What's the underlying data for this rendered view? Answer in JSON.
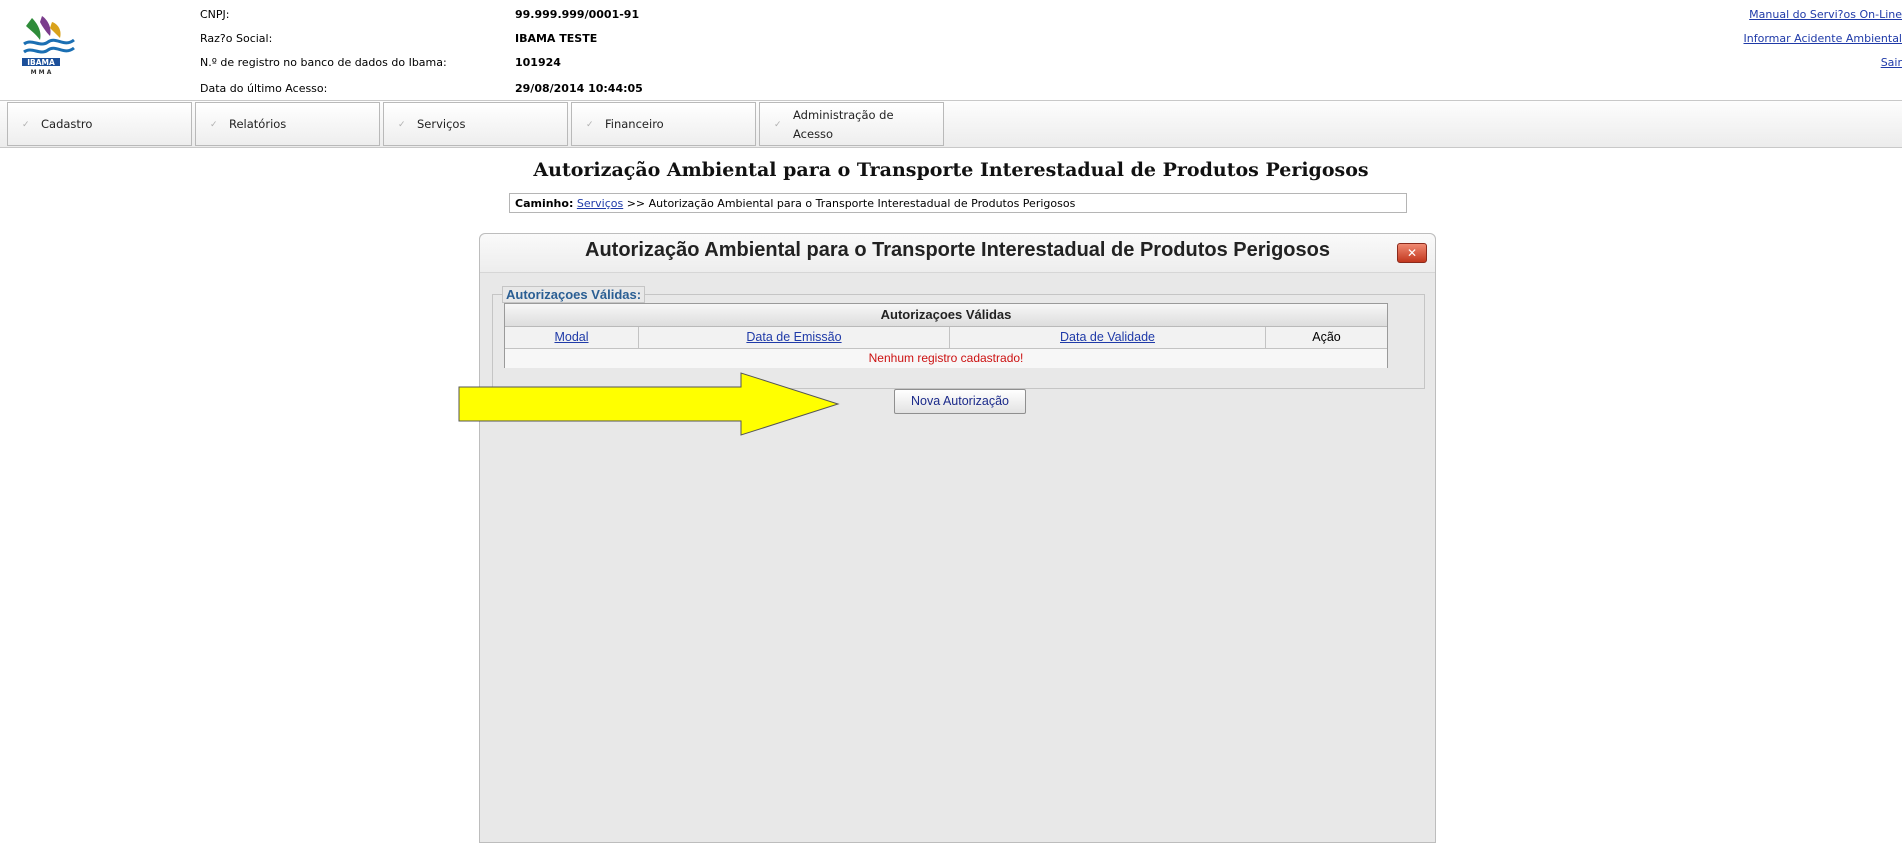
{
  "header": {
    "logo_text": "IBAMA",
    "logo_subtext": "M M A",
    "info": [
      {
        "label": "CNPJ:",
        "value": "99.999.999/0001-91"
      },
      {
        "label": "Raz?o Social:",
        "value": "IBAMA TESTE"
      },
      {
        "label": "N.º de registro no banco de dados do Ibama:",
        "value": "101924"
      },
      {
        "label": "Data do último Acesso:",
        "value": "29/08/2014 10:44:05"
      }
    ],
    "links": [
      "Manual do Servi?os On-Line",
      "Informar Acidente Ambiental",
      "Sair"
    ]
  },
  "menu": [
    {
      "label": "Cadastro"
    },
    {
      "label": "Relatórios"
    },
    {
      "label": "Serviços"
    },
    {
      "label": "Financeiro"
    },
    {
      "label_line1": "Administração de",
      "label_line2": "Acesso"
    }
  ],
  "page": {
    "title": "Autorização Ambiental para o Transporte Interestadual de Produtos Perigosos",
    "breadcrumb": {
      "prefix": "Caminho:",
      "link": "Serviços",
      "rest": " >> Autorização Ambiental para o Transporte Interestadual de Produtos Perigosos"
    }
  },
  "dialog": {
    "title": "Autorização Ambiental para o Transporte Interestadual de Produtos Perigosos",
    "close_glyph": "✕",
    "legend": "Autorizaçoes Válidas:",
    "grid": {
      "caption": "Autorizaçoes Válidas",
      "columns": [
        "Modal",
        "Data de Emissão",
        "Data de Validade",
        "Ação"
      ],
      "empty_message": "Nenhum registro cadastrado!"
    },
    "new_button": "Nova Autorização"
  },
  "colors": {
    "link": "#1f3aa8",
    "legend": "#2a5e93",
    "error": "#cc1111",
    "arrow_fill": "#ffff00"
  },
  "icons": [
    "ibama-logo-icon",
    "chevron-icon",
    "close-icon",
    "arrow-annotation-icon"
  ]
}
